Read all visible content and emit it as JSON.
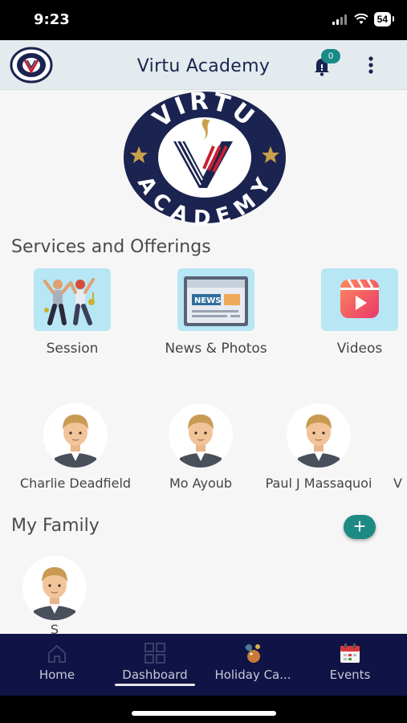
{
  "status": {
    "time": "9:23",
    "battery": "54"
  },
  "header": {
    "title": "Virtu Academy",
    "notification_count": "0"
  },
  "logo": {
    "top_text": "VIRTU",
    "bottom_text": "ACADEMY",
    "navy": "#1b2350",
    "red": "#c8202f",
    "gold": "#c9a04a"
  },
  "services": {
    "title": "Services and Offerings",
    "items": [
      {
        "label": "Session",
        "icon": "people-dancing-icon"
      },
      {
        "label": "News & Photos",
        "icon": "newspaper-icon"
      },
      {
        "label": "Videos",
        "icon": "video-reel-icon"
      }
    ]
  },
  "people": [
    {
      "name": "Charlie  Deadfield"
    },
    {
      "name": "Mo Ayoub"
    },
    {
      "name": "Paul J Massaquoi"
    },
    {
      "name": "V"
    }
  ],
  "family": {
    "title": "My Family",
    "members": [
      {
        "name": "S"
      }
    ]
  },
  "nav": {
    "items": [
      {
        "label": "Home",
        "icon": "home-icon"
      },
      {
        "label": "Dashboard",
        "icon": "dashboard-grid-icon"
      },
      {
        "label": "Holiday Ca...",
        "icon": "holiday-icon"
      },
      {
        "label": "Events",
        "icon": "calendar-icon"
      }
    ],
    "active": "Dashboard"
  },
  "colors": {
    "accent": "#1e8a84",
    "nav_bg": "#0f1346",
    "tile_bg": "#b7e6f4"
  }
}
